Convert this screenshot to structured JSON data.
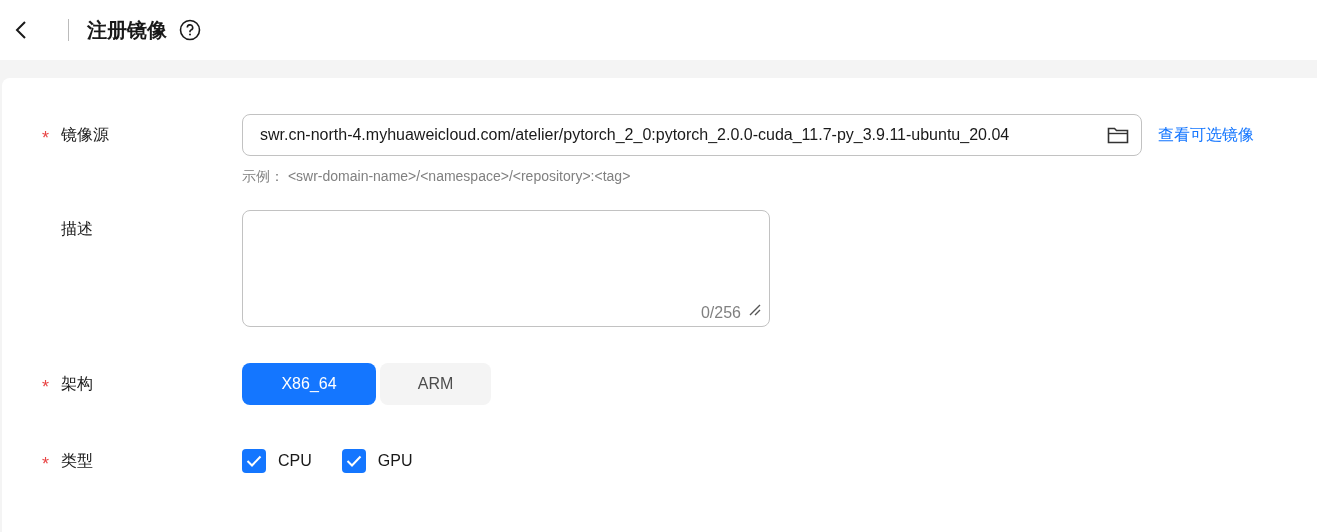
{
  "header": {
    "title": "注册镜像"
  },
  "form": {
    "source": {
      "label": "镜像源",
      "required_mark": "*",
      "value": "swr.cn-north-4.myhuaweicloud.com/atelier/pytorch_2_0:pytorch_2.0.0-cuda_11.7-py_3.9.11-ubuntu_20.04",
      "link": "查看可选镜像",
      "hint_label": "示例：",
      "hint": "<swr-domain-name>/<namespace>/<repository>:<tag>"
    },
    "description": {
      "label": "描述",
      "counter": "0/256"
    },
    "architecture": {
      "label": "架构",
      "required_mark": "*",
      "options": [
        {
          "label": "X86_64",
          "selected": true
        },
        {
          "label": "ARM",
          "selected": false
        }
      ]
    },
    "type": {
      "label": "类型",
      "required_mark": "*",
      "options": [
        {
          "label": "CPU",
          "checked": true
        },
        {
          "label": "GPU",
          "checked": true
        }
      ]
    }
  }
}
